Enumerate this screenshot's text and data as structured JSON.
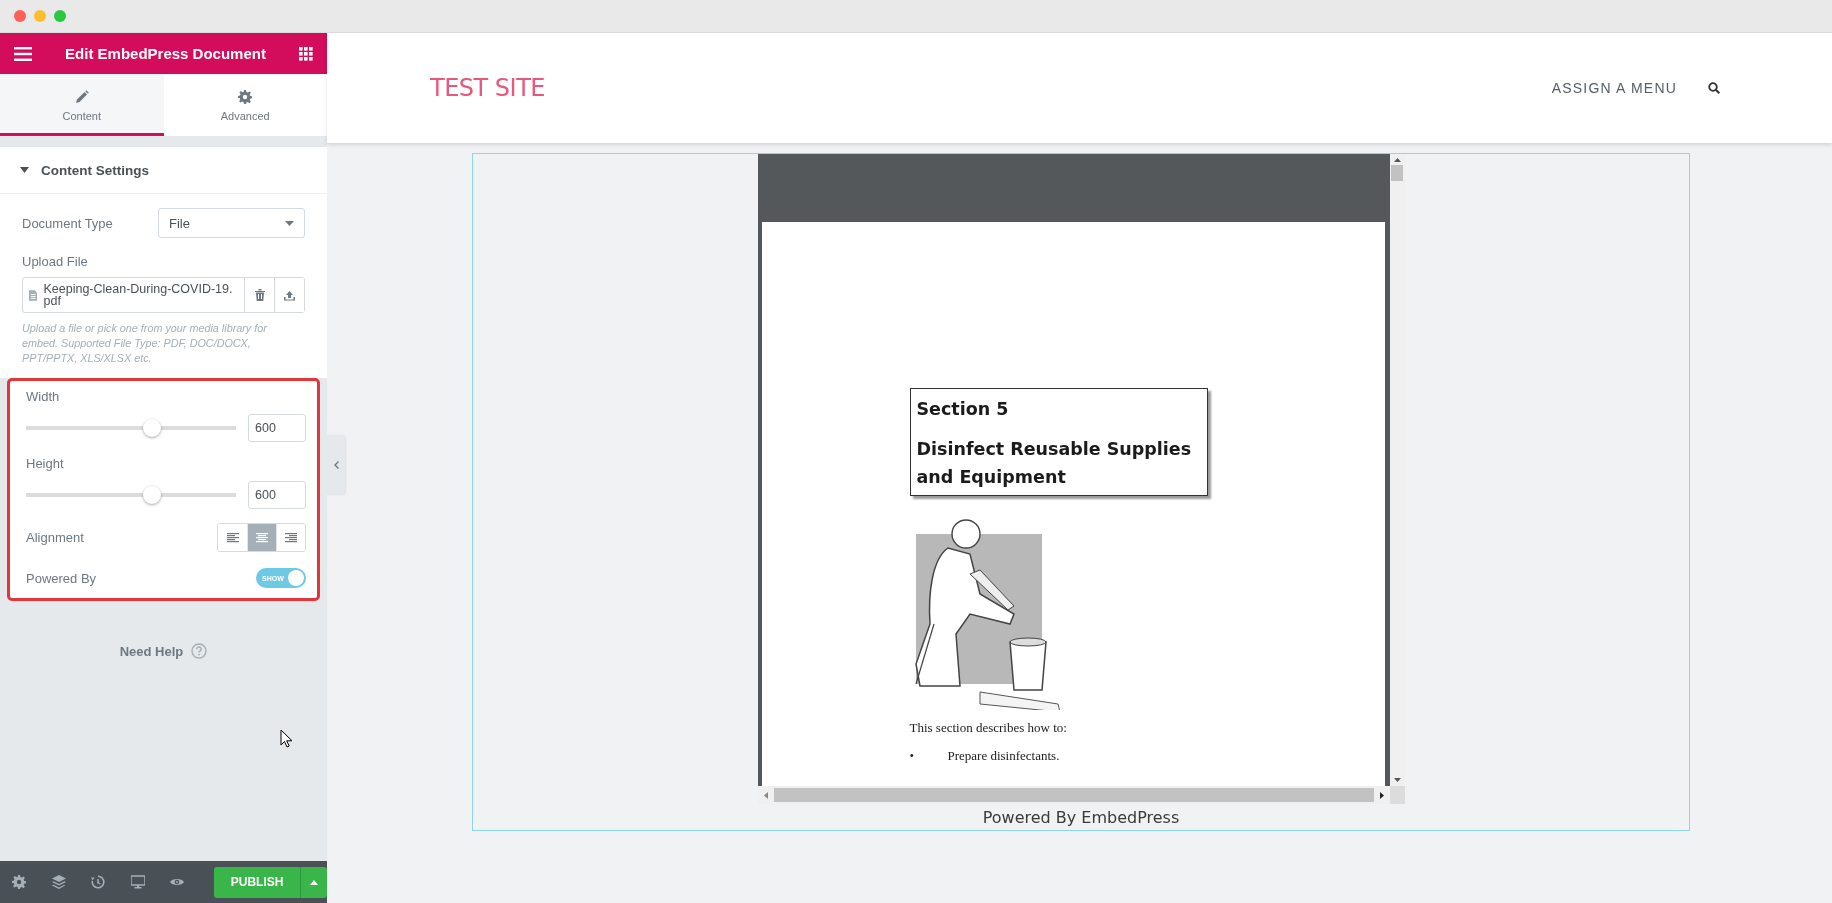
{
  "window": {
    "controls": [
      {
        "color": "#fe5f57"
      },
      {
        "color": "#febc2e"
      },
      {
        "color": "#29c840"
      }
    ]
  },
  "panel": {
    "title": "Edit EmbedPress Document",
    "tabs": [
      {
        "label": "Content",
        "selected": true
      },
      {
        "label": "Advanced",
        "selected": false
      }
    ],
    "section": {
      "title": "Content Settings",
      "expanded": true
    },
    "document_type": {
      "label": "Document Type",
      "value": "File"
    },
    "upload": {
      "label": "Upload File",
      "filename": "Keeping-Clean-During-COVID-19.pdf",
      "help": "Upload a file or pick one from your media library for embed. Supported File Type: PDF, DOC/DOCX, PPT/PPTX, XLS/XLSX etc."
    },
    "sliders": [
      {
        "label": "Width",
        "level": 0.6,
        "value": "600"
      },
      {
        "label": "Height",
        "level": 0.6,
        "value": "600"
      }
    ],
    "alignment": {
      "label": "Alignment",
      "options": [
        {
          "selected": false
        },
        {
          "selected": true
        },
        {
          "selected": false
        }
      ]
    },
    "powered_by": {
      "label": "Powered By",
      "on": true,
      "text": "SHOW"
    },
    "need_help": "Need Help",
    "publish": "PUBLISH"
  },
  "site": {
    "title": "TEST SITE",
    "menu": "ASSIGN A MENU"
  },
  "document": {
    "heading": "Section 5",
    "subheading": "Disinfect Reusable Supplies and Equipment",
    "intro": "This section describes how to:",
    "bullets": [
      {
        "mark": "•",
        "text": "Prepare disinfectants."
      }
    ]
  },
  "embed_footer": "Powered By EmbedPress"
}
